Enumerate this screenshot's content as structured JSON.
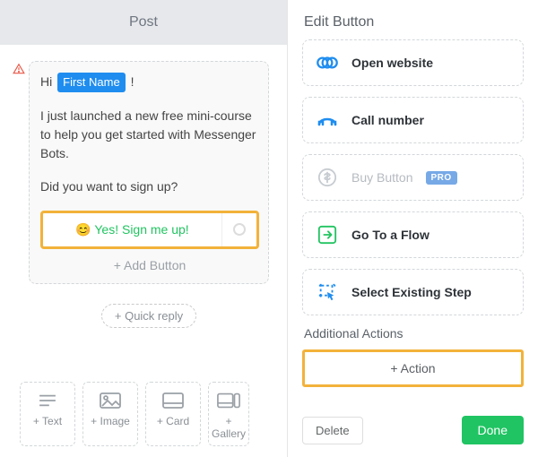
{
  "left": {
    "header": "Post",
    "greeting_pre": "Hi ",
    "greeting_token": "First Name",
    "greeting_post": " !",
    "body": "I just launched a new free mini-course to help you get started with Messenger Bots.",
    "prompt": "Did you want to sign up?",
    "button_label": "😊 Yes! Sign me up!",
    "add_button": "+ Add Button",
    "quick_reply": "+ Quick reply",
    "tools": [
      {
        "label": "+ Text"
      },
      {
        "label": "+ Image"
      },
      {
        "label": "+ Card"
      },
      {
        "label": "+ Gallery"
      }
    ]
  },
  "right": {
    "title": "Edit Button",
    "options": {
      "open_website": "Open website",
      "call_number": "Call number",
      "buy_button": "Buy Button",
      "pro_badge": "PRO",
      "go_to_flow": "Go To a Flow",
      "select_step": "Select Existing Step"
    },
    "additional_label": "Additional Actions",
    "add_action": "+ Action",
    "delete": "Delete",
    "done": "Done"
  }
}
